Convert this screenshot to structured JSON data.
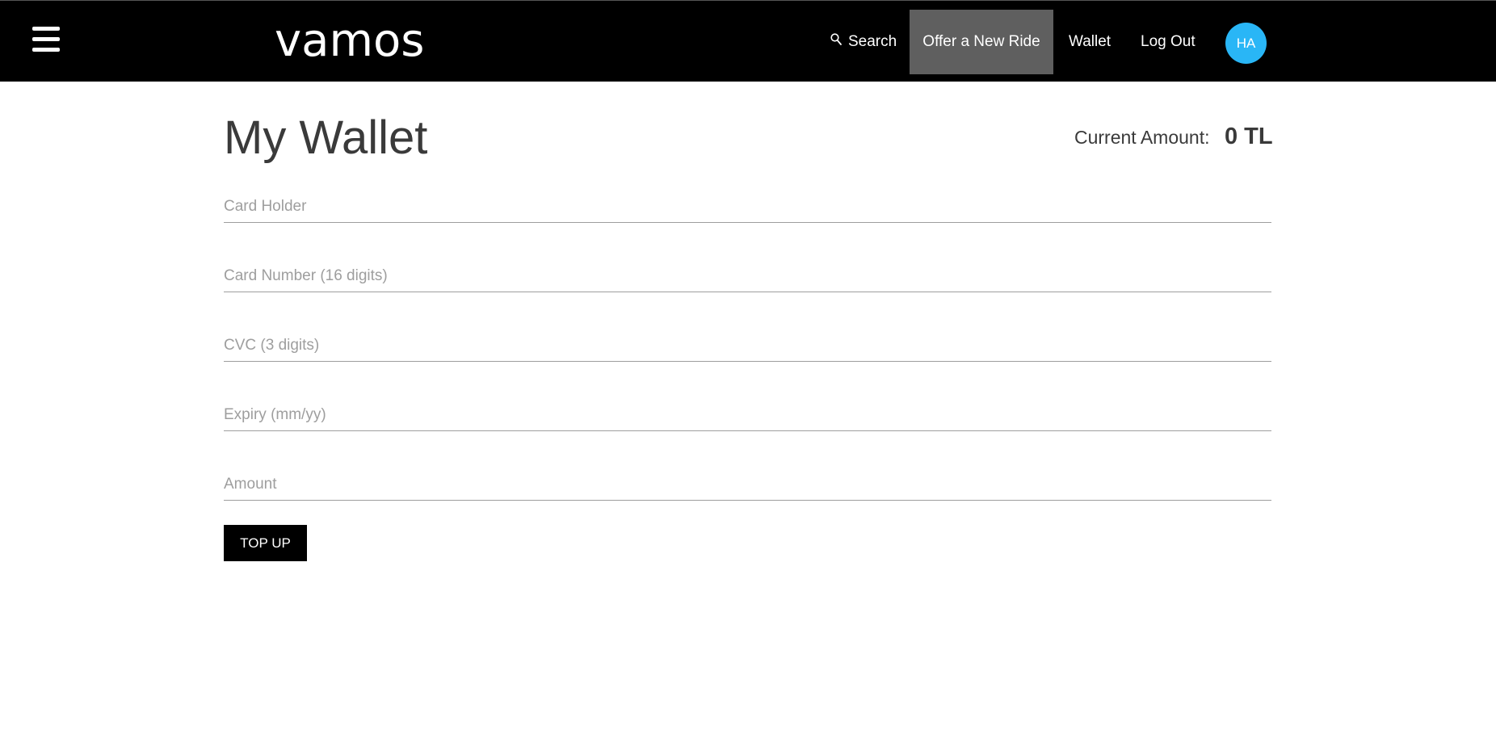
{
  "navbar": {
    "brand": "vamos",
    "search_label": "Search",
    "offer_label": "Offer a New Ride",
    "wallet_label": "Wallet",
    "logout_label": "Log Out",
    "avatar_initials": "HA",
    "icons": {
      "menu": "hamburger-menu-icon",
      "search": "search-icon"
    },
    "colors": {
      "background": "#000000",
      "active_item": "#5f5f5f",
      "avatar": "#29b6f6"
    }
  },
  "main": {
    "title": "My Wallet",
    "current_amount_label": "Current Amount:",
    "current_amount_value": "0 TL",
    "fields": {
      "card_holder": {
        "placeholder": "Card Holder",
        "value": ""
      },
      "card_number": {
        "placeholder": "Card Number (16 digits)",
        "value": ""
      },
      "cvc": {
        "placeholder": "CVC (3 digits)",
        "value": ""
      },
      "expiry": {
        "placeholder": "Expiry (mm/yy)",
        "value": ""
      },
      "amount": {
        "placeholder": "Amount",
        "value": ""
      }
    },
    "topup_label": "TOP UP"
  }
}
